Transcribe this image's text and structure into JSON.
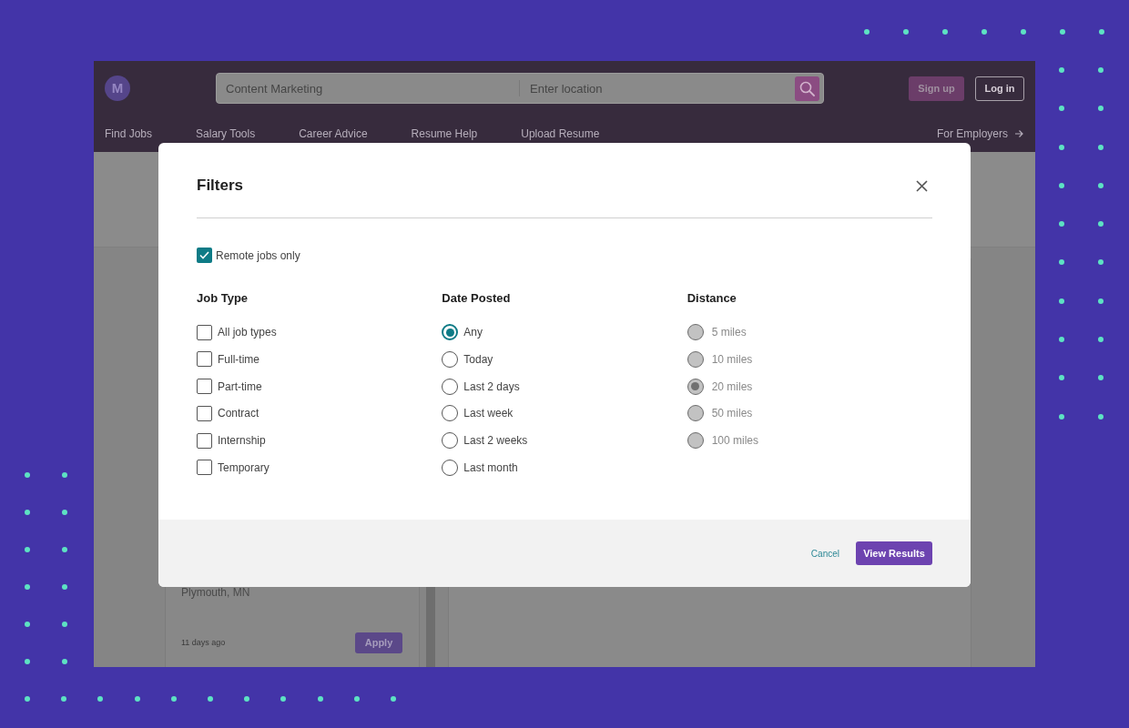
{
  "header": {
    "logo": "M",
    "search": {
      "keyword": "Content Marketing",
      "location_placeholder": "Enter location"
    },
    "buttons": [
      {
        "label": "Sign up",
        "kind": "filled"
      },
      {
        "label": "Log in",
        "kind": "outline"
      }
    ]
  },
  "nav": {
    "items": [
      "Find Jobs",
      "Salary Tools",
      "Career Advice",
      "Resume Help",
      "Upload Resume"
    ],
    "employer_link": "For Employers"
  },
  "job_card": {
    "location": "Plymouth, MN",
    "posted": "11 days ago",
    "apply_button": "Apply"
  },
  "modal": {
    "title": "Filters",
    "remote_only": {
      "label": "Remote jobs only",
      "checked": true
    },
    "groups": [
      {
        "title": "Job Type",
        "kind": "checkbox",
        "disabled": false,
        "options": [
          {
            "label": "All job types",
            "checked": false
          },
          {
            "label": "Full-time",
            "checked": false
          },
          {
            "label": "Part-time",
            "checked": false
          },
          {
            "label": "Contract",
            "checked": false
          },
          {
            "label": "Internship",
            "checked": false
          },
          {
            "label": "Temporary",
            "checked": false
          }
        ]
      },
      {
        "title": "Date Posted",
        "kind": "radio",
        "disabled": false,
        "options": [
          {
            "label": "Any",
            "selected": true
          },
          {
            "label": "Today",
            "selected": false
          },
          {
            "label": "Last 2 days",
            "selected": false
          },
          {
            "label": "Last week",
            "selected": false
          },
          {
            "label": "Last 2 weeks",
            "selected": false
          },
          {
            "label": "Last month",
            "selected": false
          }
        ]
      },
      {
        "title": "Distance",
        "kind": "radio",
        "disabled": true,
        "options": [
          {
            "label": "5 miles",
            "selected": false
          },
          {
            "label": "10 miles",
            "selected": false
          },
          {
            "label": "20 miles",
            "selected": true
          },
          {
            "label": "50 miles",
            "selected": false
          },
          {
            "label": "100 miles",
            "selected": false
          }
        ]
      }
    ],
    "footer": {
      "cancel": "Cancel",
      "submit": "View Results"
    }
  }
}
